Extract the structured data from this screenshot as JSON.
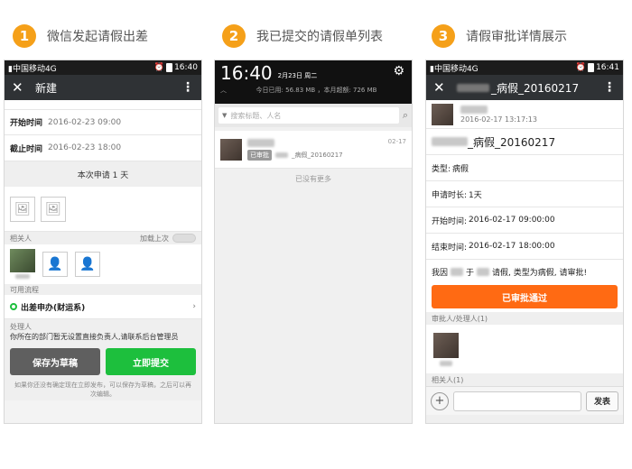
{
  "steps": [
    {
      "num": "1",
      "label": "微信发起请假出差"
    },
    {
      "num": "2",
      "label": "我已提交的请假单列表"
    },
    {
      "num": "3",
      "label": "请假审批详情展示"
    }
  ],
  "phone1": {
    "status": {
      "carrier": "中国移动4G",
      "time": "16:40"
    },
    "header": {
      "close": "✕",
      "title": "新建",
      "menu": "⋮"
    },
    "start_label": "开始时间",
    "start_value": "2016-02-23 09:00",
    "end_label": "截止时间",
    "end_value": "2016-02-23 18:00",
    "duration": "本次申请 1 天",
    "related_label": "相关人",
    "load_last": "加载上次",
    "flow_label": "可用流程",
    "flow_name": "出差申办(财运系)",
    "handler_label": "处理人",
    "handler_msg": "你所在的部门暂无设置直接负责人,请联系后台管理员",
    "save_btn": "保存为草稿",
    "submit_btn": "立即提交",
    "footer": "如果你还没有确定现在立即发布，可以保存为草稿，之后可以再次编辑。"
  },
  "phone2": {
    "time": "16:40",
    "date": "2月23日 周二",
    "usage": "今日已用: 56.83 MB ，本月超额: 726 MB",
    "search_placeholder": "搜索标题、人名",
    "item_title": "_病假_20160217",
    "item_badge": "已审批",
    "item_date": "02-17",
    "no_more": "已没有更多"
  },
  "phone3": {
    "status": {
      "carrier": "中国移动4G",
      "time": "16:41"
    },
    "header": {
      "close": "✕",
      "title": "_病假_20160217",
      "menu": "⋮"
    },
    "submit_time": "2016-02-17 13:17:13",
    "big_title": "_病假_20160217",
    "type_label": "类型:",
    "type_value": "病假",
    "dur_label": "申请时长:",
    "dur_value": "1天",
    "start_label": "开始时间:",
    "start_value": "2016-02-17 09:00:00",
    "end_label": "结束时间:",
    "end_value": "2016-02-17 18:00:00",
    "msg_a": "我因",
    "msg_b": "于",
    "msg_c": "请假, 类型为病假, 请审批!",
    "approved_btn": "已审批通过",
    "approver_label": "审批人/处理人(1)",
    "related_label": "相关人(1)",
    "send_btn": "发表"
  },
  "colors": {
    "step": "#f5a019",
    "green": "#1dbf3d",
    "orange": "#ff6a13",
    "wx_header": "#2f3235"
  }
}
